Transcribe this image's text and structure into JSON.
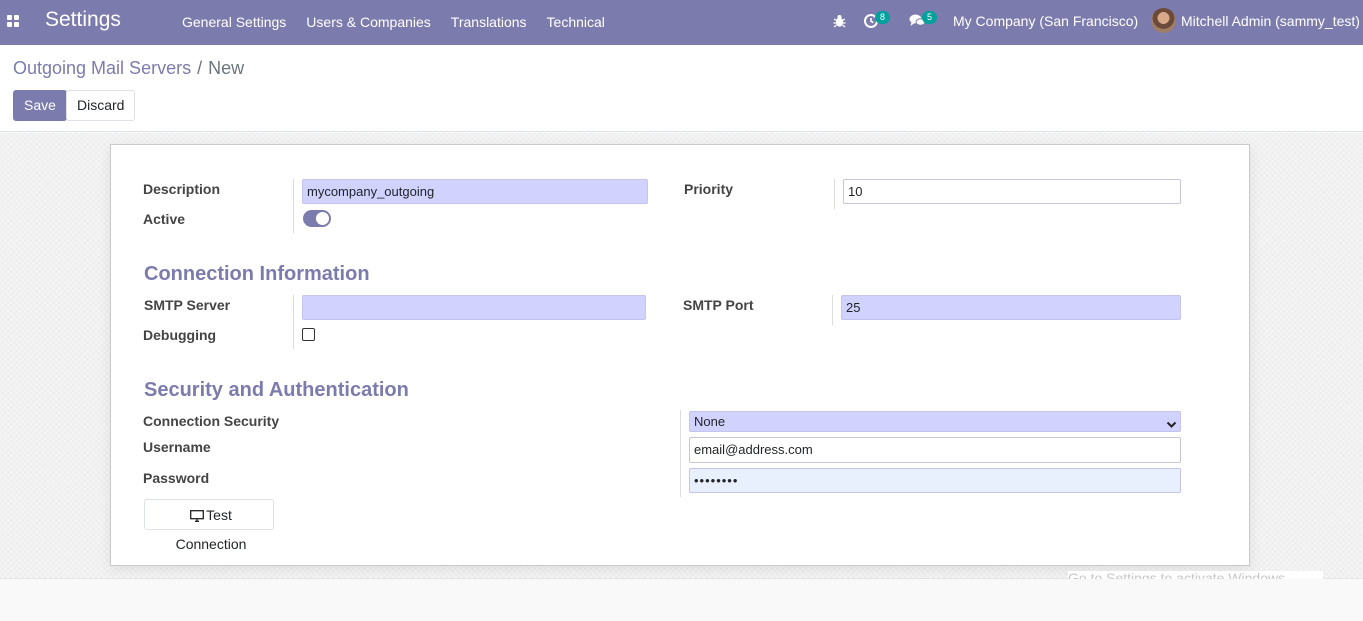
{
  "navbar": {
    "app_title": "Settings",
    "menu": [
      "General Settings",
      "Users & Companies",
      "Translations",
      "Technical"
    ],
    "activity_count": "8",
    "messages_count": "5",
    "company": "My Company (San Francisco)",
    "user": "Mitchell Admin (sammy_test)",
    "accent_color": "#7c7bad",
    "badge_color": "#00a09d"
  },
  "breadcrumb": {
    "parent": "Outgoing Mail Servers",
    "separator": "/",
    "current": "New"
  },
  "actions": {
    "save": "Save",
    "discard": "Discard"
  },
  "form": {
    "description_label": "Description",
    "description_value": "mycompany_outgoing",
    "active_label": "Active",
    "active_value": true,
    "priority_label": "Priority",
    "priority_value": "10",
    "connection_section": "Connection Information",
    "smtp_server_label": "SMTP Server",
    "smtp_server_value": "",
    "smtp_port_label": "SMTP Port",
    "smtp_port_value": "25",
    "debugging_label": "Debugging",
    "debugging_value": false,
    "security_section": "Security and Authentication",
    "connection_security_label": "Connection Security",
    "connection_security_value": "None",
    "username_label": "Username",
    "username_value": "email@address.com",
    "password_label": "Password",
    "password_value": "••••••••",
    "test_connection": "Test Connection"
  },
  "watermark": "Go to Settings to activate Windows."
}
